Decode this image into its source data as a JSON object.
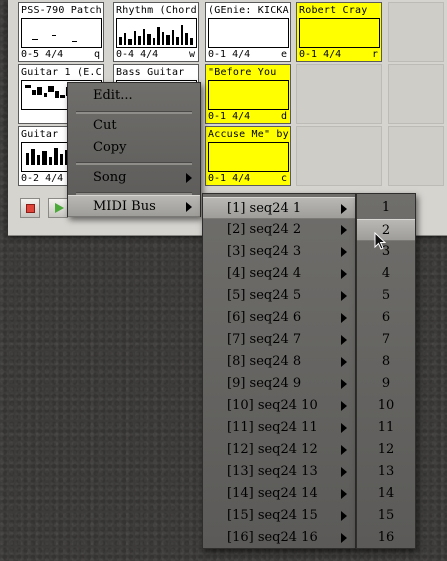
{
  "sequences": [
    {
      "title": "PSS-790 Patch",
      "measures": "0-5 4/4",
      "key": "q",
      "yellow": false
    },
    {
      "title": "Rhythm (Chord",
      "measures": "0-4 4/4",
      "key": "w",
      "yellow": false
    },
    {
      "title": "(GEnie: KICKA",
      "measures": "0-1 4/4",
      "key": "e",
      "yellow": false
    },
    {
      "title": "Robert Cray",
      "measures": "0-1 4/4",
      "key": "r",
      "yellow": true
    },
    {
      "title": "Guitar 1 (E.C",
      "measures": "",
      "key": "",
      "yellow": false
    },
    {
      "title": "Bass Guitar",
      "measures": "",
      "key": "",
      "yellow": false
    },
    {
      "title": "\"Before You",
      "measures": "0-1 4/4",
      "key": "d",
      "yellow": true
    },
    {
      "title": "Guitar",
      "measures": "0-2 4/4",
      "key": "",
      "yellow": false
    },
    {
      "title": "Accuse Me\" by",
      "measures": "0-1 4/4",
      "key": "c",
      "yellow": true
    }
  ],
  "main_menu": {
    "edit": "Edit...",
    "cut": "Cut",
    "copy": "Copy",
    "song": "Song",
    "midi_bus": "MIDI Bus"
  },
  "bus_menu": {
    "items": [
      "[1] seq24 1",
      "[2] seq24 2",
      "[3] seq24 3",
      "[4] seq24 4",
      "[5] seq24 5",
      "[6] seq24 6",
      "[7] seq24 7",
      "[8] seq24 8",
      "[9] seq24 9",
      "[10] seq24 10",
      "[11] seq24 11",
      "[12] seq24 12",
      "[13] seq24 13",
      "[14] seq24 14",
      "[15] seq24 15",
      "[16] seq24 16"
    ],
    "highlighted": 0
  },
  "channel_menu": {
    "items": [
      "1",
      "2",
      "3",
      "4",
      "5",
      "6",
      "7",
      "8",
      "9",
      "10",
      "11",
      "12",
      "13",
      "14",
      "15",
      "16"
    ],
    "highlighted": 1
  },
  "colors": {
    "active_sequence": "#ffff00",
    "menu_bg": "#666562",
    "menu_highlight": "#aeada9"
  }
}
